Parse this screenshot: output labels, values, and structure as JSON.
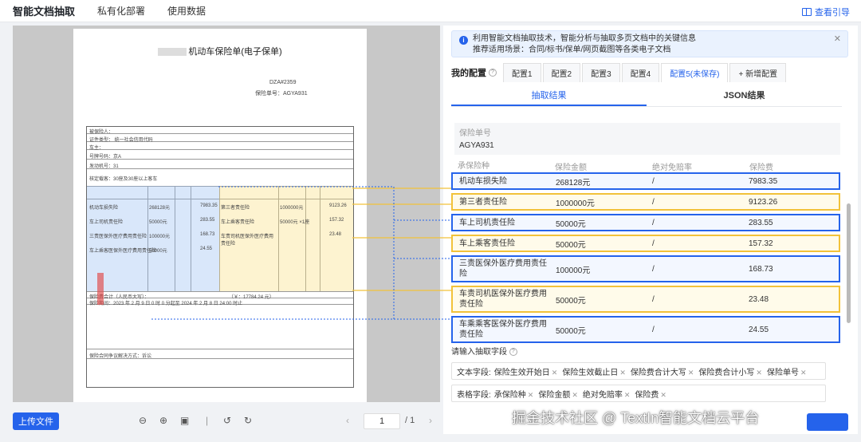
{
  "topbar": {
    "brand": "智能文档抽取",
    "nav": [
      "私有化部署",
      "使用数据"
    ],
    "guide": "查看引导"
  },
  "document": {
    "title": "机动车保险单(电子保单)",
    "policy_no_prefix": "DZA#2359",
    "ins_no_prefix": "保险单号：AGYA931",
    "header_rows": [
      "被保险人：",
      "证件类型：   统一社会信用代码",
      "车主：",
      "号牌号码：京A",
      "发动机号：31",
      "核定载客：30座及30座以上客车"
    ],
    "coverage": [
      {
        "name": "机动车损失险",
        "amount": "268128元",
        "deductible": "",
        "premium": "7983.35"
      },
      {
        "name": "车上司机责任险",
        "amount": "50000元",
        "deductible": "",
        "premium": "283.55"
      },
      {
        "name": "三责医保外医疗费用责任险",
        "amount": "100000元",
        "deductible": "",
        "premium": "168.73"
      },
      {
        "name": "车上乘客医保外医疗费用责任险",
        "amount": "50000元",
        "deductible": "",
        "premium": "24.55"
      }
    ],
    "coverage_right": [
      {
        "name": "第三者责任险",
        "amount": "1000000元",
        "premium": "9123.26"
      },
      {
        "name": "车上乘客责任险",
        "amount": "50000元 ×1座",
        "premium": "157.32"
      },
      {
        "name": "车责司机医保外医疗费用责任险",
        "amount": "50000元",
        "premium": "23.48"
      }
    ],
    "total": "保险费合计（人民币大写）：",
    "total_small": "（￥：17784.24 元）",
    "period": "保险期间：2023 年 2 月 9 日 0 时 0 分起至 2024 年 2 月 8 日 24:00 时止",
    "dispute": "保险合同争议解决方式：诉讼"
  },
  "viewer": {
    "upload": "上传文件",
    "page": "1",
    "total": "/ 1"
  },
  "panel": {
    "notice_line1": "利用智能文档抽取技术，智能分析与抽取多页文档中的关键信息",
    "notice_line2": "推荐适用场景：合同/标书/保单/网页截图等各类电子文档",
    "config_label": "我的配置",
    "config_tabs": [
      "配置1",
      "配置2",
      "配置3",
      "配置4",
      "配置5(未保存)",
      "+ 新增配置"
    ],
    "result_tabs": [
      "抽取结果",
      "JSON结果"
    ],
    "policy_label": "保险单号",
    "policy_value": "AGYA931",
    "table_headers": [
      "承保险种",
      "保险金额",
      "绝对免赔率",
      "保险费"
    ],
    "rows": [
      {
        "name": "机动车损失险",
        "amount": "268128元",
        "rate": "/",
        "fee": "7983.35",
        "color": "blue"
      },
      {
        "name": "第三者责任险",
        "amount": "1000000元",
        "rate": "/",
        "fee": "9123.26",
        "color": "yellow"
      },
      {
        "name": "车上司机责任险",
        "amount": "50000元",
        "rate": "/",
        "fee": "283.55",
        "color": "blue"
      },
      {
        "name": "车上乘客责任险",
        "amount": "50000元",
        "rate": "/",
        "fee": "157.32",
        "color": "yellow"
      },
      {
        "name": "三责医保外医疗费用责任险",
        "amount": "100000元",
        "rate": "/",
        "fee": "168.73",
        "color": "blue"
      },
      {
        "name": "车责司机医保外医疗费用责任险",
        "amount": "50000元",
        "rate": "/",
        "fee": "23.48",
        "color": "yellow"
      },
      {
        "name": "车乘乘客医保外医疗费用责任险",
        "amount": "50000元",
        "rate": "/",
        "fee": "24.55",
        "color": "blue"
      }
    ],
    "field_title": "请输入抽取字段",
    "text_label": "文本字段:",
    "text_fields": [
      "保险生效开始日",
      "保险生效截止日",
      "保险费合计大写",
      "保险费合计小写",
      "保险单号"
    ],
    "table_label": "表格字段:",
    "table_fields": [
      "承保险种",
      "保险金额",
      "绝对免赔率",
      "保险费"
    ]
  },
  "watermark": "掘金技术社区 @ TextIn智能文档云平台",
  "colors": {
    "accent": "#2563eb",
    "blue_box": "#2563eb",
    "yellow_box": "#f2c23a"
  }
}
